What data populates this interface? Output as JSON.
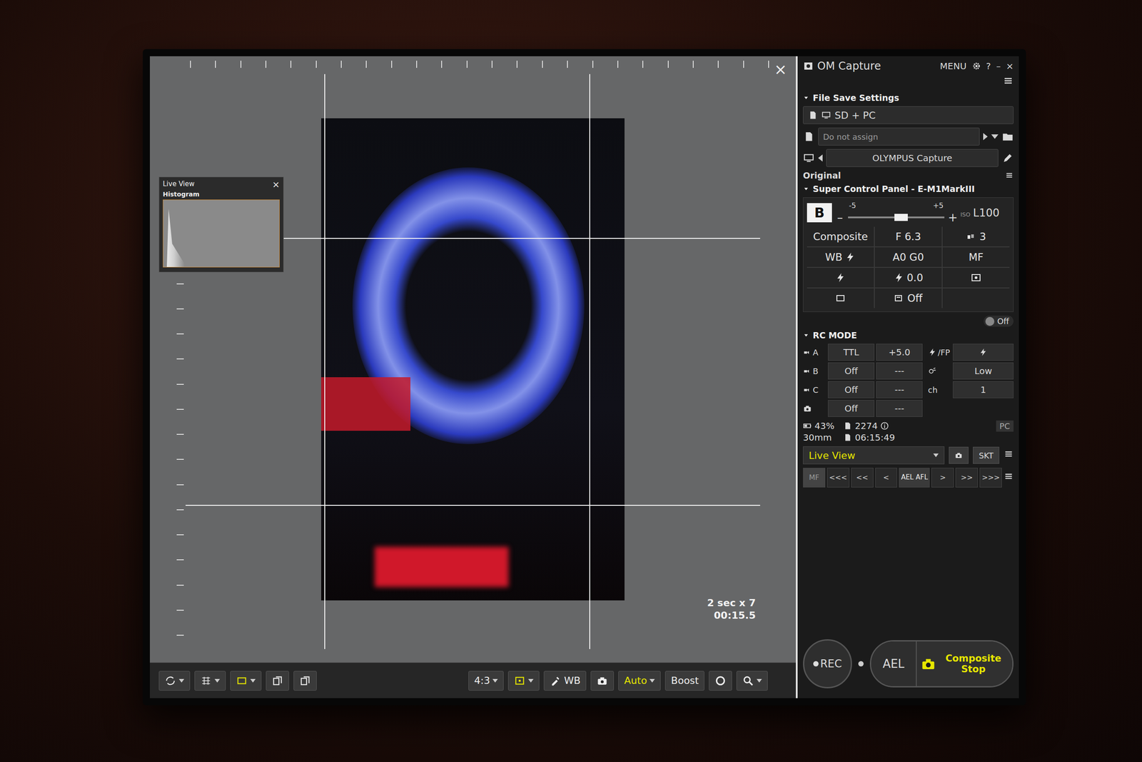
{
  "window": {
    "title": "OM Capture",
    "menu": "MENU",
    "controls": [
      "?",
      "–",
      "×"
    ]
  },
  "live_view": {
    "close": "×",
    "histogram": {
      "title": "Live View",
      "label": "Histogram",
      "close": "×"
    },
    "exposure": {
      "interval": "2 sec x 7",
      "elapsed": "00:15.5"
    }
  },
  "toolbar_left": [
    {
      "kind": "rotate",
      "highlighted": false,
      "dropdown": true
    },
    {
      "kind": "grid",
      "highlighted": false,
      "dropdown": true
    },
    {
      "kind": "frame",
      "highlighted": true,
      "dropdown": true
    },
    {
      "kind": "copy",
      "highlighted": false,
      "dropdown": false
    },
    {
      "kind": "export",
      "highlighted": false,
      "dropdown": false
    }
  ],
  "toolbar_center": [
    {
      "kind": "text",
      "label": "4:3",
      "highlighted": false,
      "dropdown": true
    },
    {
      "kind": "af-target",
      "label": "",
      "highlighted": true,
      "dropdown": true
    },
    {
      "kind": "picker",
      "label": "WB",
      "highlighted": false,
      "dropdown": false
    },
    {
      "kind": "camera-home",
      "label": "",
      "highlighted": false,
      "dropdown": false
    },
    {
      "kind": "text",
      "label": "Auto",
      "highlighted": true,
      "dropdown": true
    },
    {
      "kind": "text",
      "label": "Boost",
      "highlighted": false,
      "dropdown": false
    },
    {
      "kind": "aperture",
      "label": "",
      "highlighted": false,
      "dropdown": false
    },
    {
      "kind": "zoom",
      "label": "",
      "highlighted": false,
      "dropdown": true
    }
  ],
  "file_save": {
    "title": "File Save Settings",
    "destination": "SD + PC",
    "assign": "Do not assign",
    "folder": "OLYMPUS Capture",
    "format": "Original"
  },
  "super_control": {
    "title": "Super Control Panel - E-M1MarkIII",
    "mode": "B",
    "minus": "–",
    "plus": "+",
    "min": "-5",
    "max": "+5",
    "level": 0.55,
    "iso_label": "ISO",
    "iso": "L100",
    "cells": [
      {
        "kind": "text",
        "text": "Composite"
      },
      {
        "kind": "text",
        "text": "F 6.3"
      },
      {
        "kind": "drive",
        "text": "3"
      },
      {
        "kind": "wb-flash",
        "text": "WB"
      },
      {
        "kind": "text",
        "text": "A0 G0"
      },
      {
        "kind": "text",
        "text": "MF"
      },
      {
        "kind": "flash",
        "text": ""
      },
      {
        "kind": "flash-comp",
        "text": "0.0"
      },
      {
        "kind": "metering",
        "text": ""
      },
      {
        "kind": "aspect",
        "text": ""
      },
      {
        "kind": "drive-off",
        "text": "Off"
      },
      {
        "kind": "empty",
        "text": ""
      }
    ]
  },
  "flash_toggle": {
    "label": "Off",
    "on": false
  },
  "rc_mode": {
    "title": "RC MODE",
    "groups": [
      {
        "kind": "group",
        "name": "A",
        "mode": "TTL",
        "value": "+5.0"
      },
      {
        "kind": "group",
        "name": "B",
        "mode": "Off",
        "value": "---"
      },
      {
        "kind": "group",
        "name": "C",
        "mode": "Off",
        "value": "---"
      },
      {
        "kind": "camera",
        "name": "",
        "mode": "Off",
        "value": "---"
      }
    ],
    "settings": [
      {
        "kind": "flash-fp",
        "label": "/FP",
        "value": ""
      },
      {
        "kind": "power",
        "label": "",
        "value": "Low"
      },
      {
        "kind": "channel",
        "label": "ch",
        "value": "1"
      }
    ]
  },
  "status": {
    "battery": "43%",
    "focal_length": "30mm",
    "shots": "2274",
    "remaining": "06:15:49",
    "pc": "PC"
  },
  "view_select": {
    "label": "Live View"
  },
  "skt": "SKT",
  "focus_steps": [
    {
      "label": "MF",
      "kind": "mode"
    },
    {
      "label": "<<<",
      "kind": "step"
    },
    {
      "label": "<<",
      "kind": "step"
    },
    {
      "label": "<",
      "kind": "step"
    },
    {
      "label": "AEL AFL",
      "kind": "lock"
    },
    {
      "label": ">",
      "kind": "step"
    },
    {
      "label": ">>",
      "kind": "step"
    },
    {
      "label": ">>>",
      "kind": "step"
    }
  ],
  "buttons": {
    "rec": "REC",
    "ael": "AEL",
    "shutter": "Composite Stop"
  }
}
